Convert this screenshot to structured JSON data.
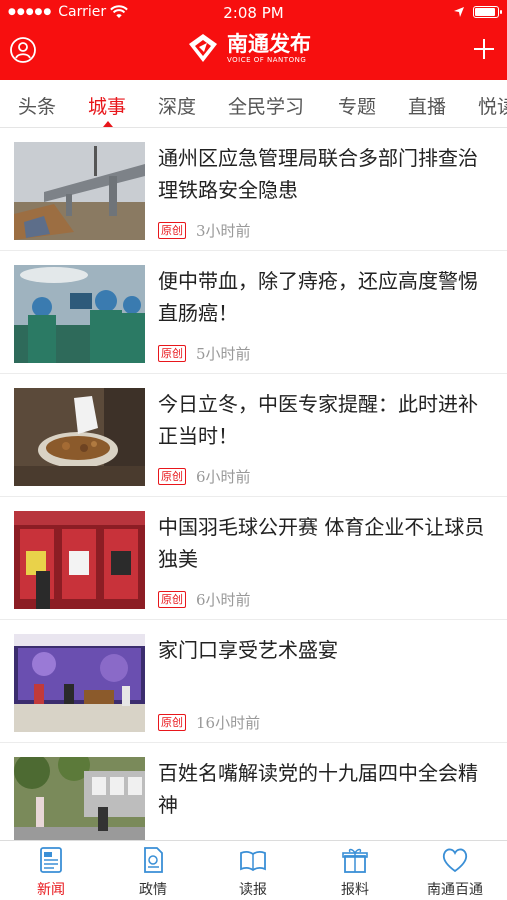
{
  "status_bar": {
    "carrier": "Carrier",
    "time": "2:08 PM",
    "battery_level": 0.9
  },
  "app": {
    "name": "南通发布",
    "subtitle": "VOICE OF NANTONG"
  },
  "tabs": [
    {
      "label": "头条",
      "active": false
    },
    {
      "label": "城事",
      "active": true
    },
    {
      "label": "深度",
      "active": false
    },
    {
      "label": "全民学习",
      "active": false
    },
    {
      "label": "专题",
      "active": false
    },
    {
      "label": "直播",
      "active": false
    },
    {
      "label": "悦读",
      "active": false
    }
  ],
  "news": [
    {
      "title": "通州区应急管理局联合多部门排查治理铁路安全隐患",
      "badge": "原创",
      "time": "3小时前",
      "image": "railway-bridge-photo"
    },
    {
      "title": "便中带血，除了痔疮，还应高度警惕直肠癌！",
      "badge": "原创",
      "time": "5小时前",
      "image": "surgery-photo"
    },
    {
      "title": "今日立冬，中医专家提醒：此时进补正当时！",
      "badge": "原创",
      "time": "6小时前",
      "image": "herbal-medicine-photo"
    },
    {
      "title": "中国羽毛球公开赛 体育企业不让球员独美",
      "badge": "原创",
      "time": "6小时前",
      "image": "badminton-exhibition-photo"
    },
    {
      "title": "家门口享受艺术盛宴",
      "badge": "原创",
      "time": "16小时前",
      "image": "stage-performance-photo"
    },
    {
      "title": "百姓名嘴解读党的十九届四中全会精神",
      "badge": "",
      "time": "",
      "image": "outdoor-lecture-photo"
    }
  ],
  "bottom_nav": [
    {
      "label": "新闻",
      "icon": "newspaper-icon",
      "active": true
    },
    {
      "label": "政情",
      "icon": "document-icon",
      "active": false
    },
    {
      "label": "读报",
      "icon": "read-paper-icon",
      "active": false
    },
    {
      "label": "报料",
      "icon": "gift-box-icon",
      "active": false
    },
    {
      "label": "南通百通",
      "icon": "heart-icon",
      "active": false
    }
  ],
  "colors": {
    "brand_red": "#f70f0f",
    "accent_red": "#e8161b",
    "nav_blue": "#3a8fd6"
  }
}
